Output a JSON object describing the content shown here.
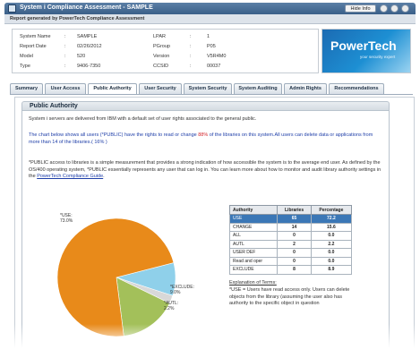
{
  "window": {
    "title": "System i Compliance Assessment - SAMPLE",
    "hide_info_label": "Hide Info"
  },
  "subtitle": "Report generated by PowerTech Compliance Assessment",
  "system_info": {
    "left": [
      {
        "label": "System Name",
        "value": "SAMPLE"
      },
      {
        "label": "Report Date",
        "value": "02/26/2012"
      },
      {
        "label": "Model",
        "value": "520"
      },
      {
        "label": "Type",
        "value": "9406-7350"
      }
    ],
    "right": [
      {
        "label": "LPAR",
        "value": "1"
      },
      {
        "label": "PGroup",
        "value": "P05"
      },
      {
        "label": "Version",
        "value": "V5R4M0"
      },
      {
        "label": "CCSID",
        "value": "00037"
      }
    ]
  },
  "logo": {
    "text": "PowerTech",
    "tagline": "your security expert"
  },
  "tabs": [
    "Summary",
    "User Access",
    "Public Authority",
    "User Security",
    "System Security",
    "System Auditing",
    "Admin Rights",
    "Recommendations"
  ],
  "active_tab": "Public Authority",
  "panel": {
    "title": "Public Authority",
    "intro": "System i servers are delivered from IBM with a default set of user rights associated to the general public.",
    "chart_text_1": "The chart below shows all users (*PUBLIC) have the rights to read or change ",
    "chart_text_pct": "88%",
    "chart_text_2": " of the libraries on this system.All users can delete data or applications from more than 14 of the libraries.( 16% )",
    "description": "*PUBLIC access to libraries is a simple measurement that provides a strong indication of how accessible the system is to the average end user. As defined by the OS/400 operating system, *PUBLIC essentially represents any user that can log in. You can learn more about how to monitor and audit library authority settings in the ",
    "guide_link": "PowerTech Compliance Guide",
    "description_end": "."
  },
  "authority_table": {
    "headers": [
      "Authority",
      "Libraries",
      "Percentage"
    ],
    "rows": [
      {
        "authority": "USE",
        "libraries": "65",
        "percentage": "72.2"
      },
      {
        "authority": "CHANGE",
        "libraries": "14",
        "percentage": "15.6"
      },
      {
        "authority": "ALL",
        "libraries": "0",
        "percentage": "0.0"
      },
      {
        "authority": "AUTL",
        "libraries": "2",
        "percentage": "2.2"
      },
      {
        "authority": "USER DEF",
        "libraries": "0",
        "percentage": "0.0"
      },
      {
        "authority": "Read and oper",
        "libraries": "0",
        "percentage": "0.0"
      },
      {
        "authority": "EXCLUDE",
        "libraries": "8",
        "percentage": "8.9"
      }
    ]
  },
  "explanation": {
    "heading": "Explanation of Terms:",
    "text": "*USE = Users have read access only. Users can delete objects from the library (assuming the user also has authority to the specific object in question"
  },
  "chart_data": {
    "type": "pie",
    "title": "",
    "slices": [
      {
        "label": "*USE:",
        "value": 73.0,
        "display": "73.0%",
        "color": "#e88a1a"
      },
      {
        "label": "*EXCLUDE:",
        "value": 9.0,
        "display": "9.0%",
        "color": "#8fd0ea"
      },
      {
        "label": "*AUTL:",
        "value": 2.2,
        "display": "2.2%",
        "color": "#d8d8d8"
      },
      {
        "label": "*CHANGE",
        "value": 15.8,
        "display": "",
        "color": "#a3c05a"
      }
    ]
  }
}
